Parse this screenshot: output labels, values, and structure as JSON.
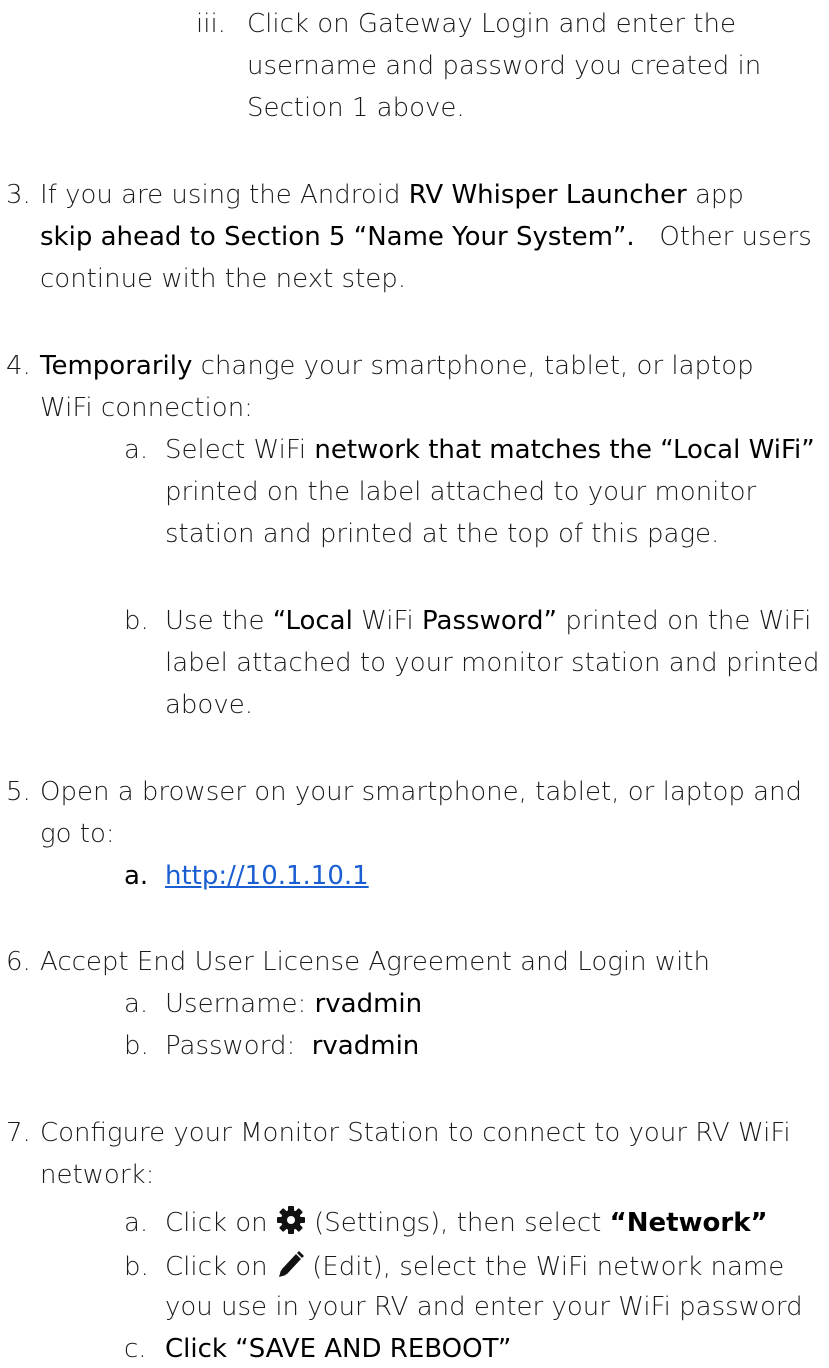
{
  "colors": {
    "text": "#1a1a1a",
    "link": "#1a5fd1"
  },
  "sub_iii": {
    "marker": "iii.",
    "line1": "Click on Gateway Login and enter the",
    "line2": "username and password you created in",
    "line3": "Section 1 above."
  },
  "step3": {
    "num": "3.",
    "l1_a": "If you are using the Android ",
    "l1_bold": "RV Whisper Launcher",
    "l1_b": " app",
    "l2_m": "skip ahead to Section 5 “Name Your System”.",
    "l2_b": "   Other users",
    "l3": "continue with the next step."
  },
  "step4": {
    "num": "4.",
    "l1_bold": "Temporarily",
    "l1_b": " change your smartphone, tablet, or laptop",
    "l2": "WiFi connection:",
    "a": {
      "marker": "a.",
      "l1_a": "Select WiFi ",
      "l1_m": "network that matches the “Local WiFi”",
      "l2": "printed on the label attached to your monitor",
      "l3": "station and printed at the top of this page."
    },
    "b": {
      "marker": "b.",
      "l1_a": "Use the ",
      "l1_m1": "“Local",
      "l1_b": " WiFi ",
      "l1_m2": "Password”",
      "l1_c": " printed on the WiFi",
      "l2": "label attached to your monitor station and printed",
      "l3": "above."
    }
  },
  "step5": {
    "num": "5.",
    "l1": "Open a browser on your smartphone, tablet, or laptop and",
    "l2": "go to:",
    "a_marker": "a.",
    "url": "http://10.1.10.1"
  },
  "step6": {
    "num": "6.",
    "l1": "Accept End User License Agreement and Login with",
    "a_marker": "a.",
    "a_label": "Username: ",
    "a_value": "rvadmin",
    "b_marker": "b.",
    "b_label": "Password:  ",
    "b_value": "rvadmin"
  },
  "step7": {
    "num": "7.",
    "l1": "Configure your Monitor Station to connect to your RV WiFi",
    "l2": "network:",
    "a": {
      "marker": "a.",
      "pre": "Click on ",
      "icon": "gear-icon",
      "post": " (Settings), then select ",
      "bold": "“Network”"
    },
    "b": {
      "marker": "b.",
      "pre": "Click on ",
      "icon": "pencil-icon",
      "post": " (Edit), select the WiFi network name",
      "l2": "you use in your RV and enter your WiFi password"
    },
    "c": {
      "marker": "c.",
      "text": "Click “SAVE AND REBOOT”"
    }
  }
}
